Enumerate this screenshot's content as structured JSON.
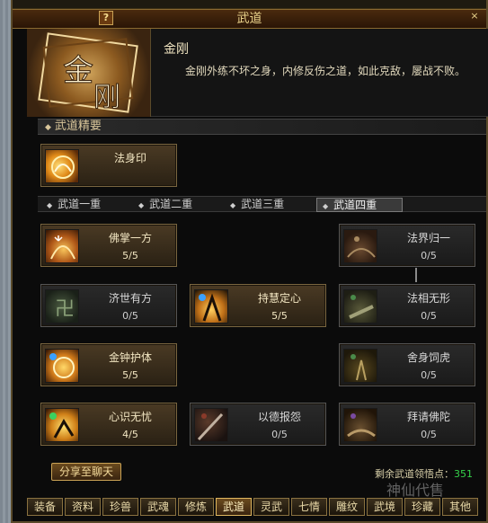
{
  "window": {
    "title": "武道",
    "help_label": "?",
    "close_label": "×"
  },
  "header": {
    "skill_name": "金刚",
    "description": "金刚外练不坏之身，内修反伤之道，如此克敌，屡战不败。"
  },
  "essentials": {
    "title": "武道精要",
    "item": {
      "name": "法身印",
      "icon": "seal-icon"
    }
  },
  "tabs": [
    {
      "label": "武道一重",
      "active": false
    },
    {
      "label": "武道二重",
      "active": false
    },
    {
      "label": "武道三重",
      "active": false
    },
    {
      "label": "武道四重",
      "active": true
    }
  ],
  "skills": [
    {
      "name": "佛掌一方",
      "level": "5/5",
      "learned": true,
      "icon": "palm-icon"
    },
    {
      "name": "法界归一",
      "level": "0/5",
      "learned": false,
      "icon": "realm-icon"
    },
    {
      "name": "济世有方",
      "level": "0/5",
      "learned": false,
      "icon": "swastika-icon"
    },
    {
      "name": "持慧定心",
      "level": "5/5",
      "learned": true,
      "icon": "wisdom-icon"
    },
    {
      "name": "法相无形",
      "level": "0/5",
      "learned": false,
      "icon": "formless-icon"
    },
    {
      "name": "金钟护体",
      "level": "5/5",
      "learned": true,
      "icon": "bell-shield-icon"
    },
    {
      "name": "舍身饲虎",
      "level": "0/5",
      "learned": false,
      "icon": "sacrifice-icon"
    },
    {
      "name": "心识无忧",
      "level": "4/5",
      "learned": true,
      "icon": "mind-icon"
    },
    {
      "name": "以德报怨",
      "level": "0/5",
      "learned": false,
      "icon": "virtue-icon"
    },
    {
      "name": "拜请佛陀",
      "level": "0/5",
      "learned": false,
      "icon": "prayer-icon"
    }
  ],
  "footer": {
    "share_label": "分享至聊天",
    "points_label": "剩余武道领悟点：",
    "points_value": "351"
  },
  "bottom_tabs": [
    {
      "label": "装备",
      "active": false
    },
    {
      "label": "资料",
      "active": false
    },
    {
      "label": "珍兽",
      "active": false
    },
    {
      "label": "武魂",
      "active": false
    },
    {
      "label": "修炼",
      "active": false
    },
    {
      "label": "武道",
      "active": true
    },
    {
      "label": "灵武",
      "active": false
    },
    {
      "label": "七情",
      "active": false
    },
    {
      "label": "雕纹",
      "active": false
    },
    {
      "label": "武境",
      "active": false
    },
    {
      "label": "珍藏",
      "active": false
    },
    {
      "label": "其他",
      "active": false
    }
  ],
  "watermark": "神仙代售",
  "colors": {
    "gold_text": "#f2e6c2",
    "points_green": "#36d04a",
    "frame_gold": "#7a6640"
  }
}
